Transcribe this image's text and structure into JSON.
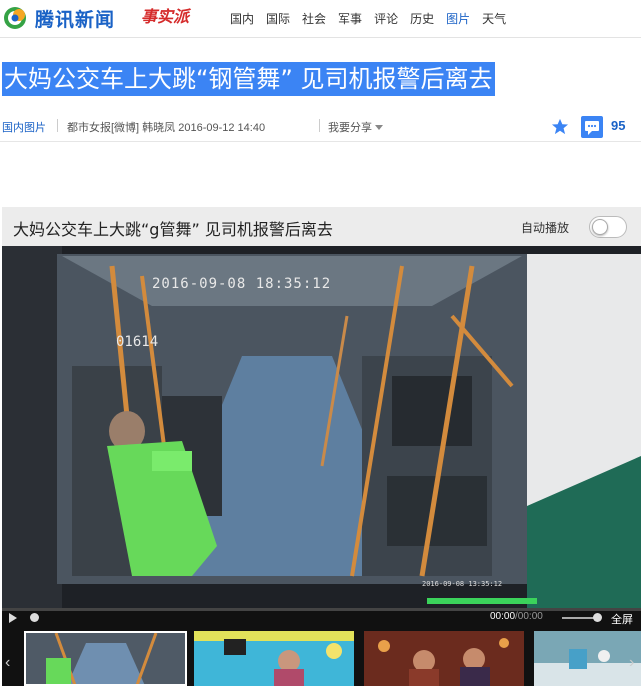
{
  "site": {
    "logo_text": "腾讯新闻",
    "logo_sub": "事实派",
    "nav": [
      {
        "label": "国内"
      },
      {
        "label": "国际"
      },
      {
        "label": "社会"
      },
      {
        "label": "军事"
      },
      {
        "label": "评论"
      },
      {
        "label": "历史"
      },
      {
        "label": "图片",
        "active": true
      },
      {
        "label": "天气"
      }
    ]
  },
  "article": {
    "title": "大妈公交车上大跳“钢管舞” 见司机报警后离去",
    "category": "国内图片",
    "source": "都市女报[微博] 韩晓凤  2016-09-12 14:40",
    "share_label": "我要分享",
    "comment_count": "95"
  },
  "player": {
    "title": "大妈公交车上大跳“g管舞” 见司机报警后离去",
    "autoplay_label": "自动播放",
    "current_time": "00:00",
    "total_time": "/00:00",
    "fullscreen_label": "全屏",
    "video_osd_timestamp": "2016-09-08 18:35:12",
    "video_osd_id": "01614",
    "video_osd_bottom_time": "2016-09-08 13:35:12"
  },
  "colors": {
    "brand_blue": "#1a62c6",
    "title_highlight": "#3b84f4"
  }
}
